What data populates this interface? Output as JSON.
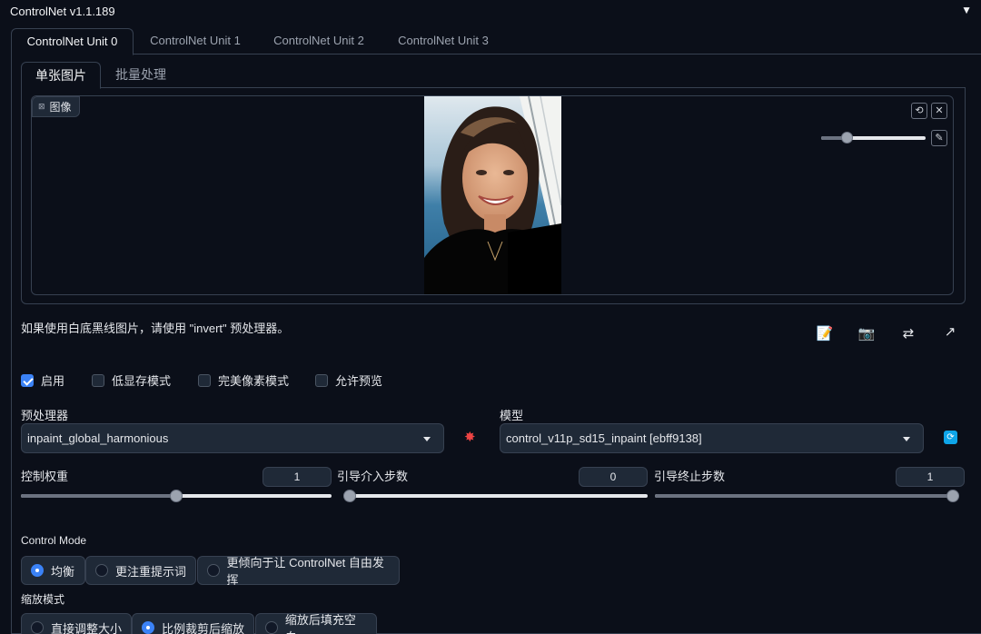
{
  "header": {
    "title": "ControlNet v1.1.189",
    "toggle_icon": "▼"
  },
  "unit_tabs": [
    "ControlNet Unit 0",
    "ControlNet Unit 1",
    "ControlNet Unit 2",
    "ControlNet Unit 3"
  ],
  "unit_tab_active": 0,
  "inner_tabs": [
    "单张图片",
    "批量处理"
  ],
  "inner_tab_active": 0,
  "image": {
    "label": "图像",
    "brush_size": 0.22
  },
  "hint": "如果使用白底黑线图片，请使用 \"invert\" 预处理器。",
  "checkboxes": [
    {
      "label": "启用",
      "checked": true
    },
    {
      "label": "低显存模式",
      "checked": false
    },
    {
      "label": "完美像素模式",
      "checked": false
    },
    {
      "label": "允许预览",
      "checked": false
    }
  ],
  "preprocessor": {
    "label": "预处理器",
    "value": "inpaint_global_harmonious"
  },
  "model": {
    "label": "模型",
    "value": "control_v11p_sd15_inpaint [ebff9138]"
  },
  "sliders": [
    {
      "label": "控制权重",
      "value": "1",
      "fraction": 0.5
    },
    {
      "label": "引导介入步数",
      "value": "0",
      "fraction": 0.0
    },
    {
      "label": "引导终止步数",
      "value": "1",
      "fraction": 1.0
    }
  ],
  "control_mode": {
    "label": "Control Mode",
    "options": [
      "均衡",
      "更注重提示词",
      "更倾向于让 ControlNet 自由发挥"
    ],
    "selected": 0
  },
  "resize_mode": {
    "label": "缩放模式",
    "options": [
      "直接调整大小",
      "比例裁剪后缩放",
      "缩放后填充空白"
    ],
    "selected": 1
  },
  "colors": {
    "accent": "#3b82f6",
    "background": "#0b0f19",
    "panel": "#1f2937",
    "border": "#374151"
  }
}
